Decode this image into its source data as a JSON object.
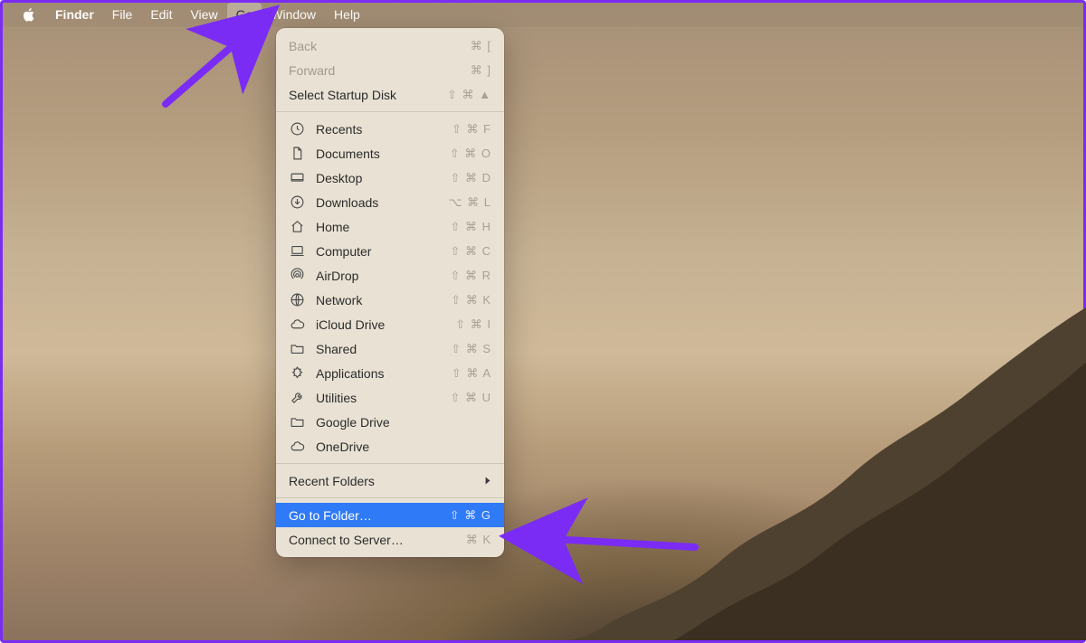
{
  "menubar": {
    "app": "Finder",
    "items": [
      "File",
      "Edit",
      "View",
      "Go",
      "Window",
      "Help"
    ],
    "open_index": 3
  },
  "dropdown": {
    "section_nav": [
      {
        "label": "Back",
        "shortcut": "⌘ [",
        "disabled": true
      },
      {
        "label": "Forward",
        "shortcut": "⌘ ]",
        "disabled": true
      },
      {
        "label": "Select Startup Disk",
        "shortcut": "⇧ ⌘ ▲"
      }
    ],
    "section_places": [
      {
        "label": "Recents",
        "shortcut": "⇧ ⌘ F",
        "icon": "clock"
      },
      {
        "label": "Documents",
        "shortcut": "⇧ ⌘ O",
        "icon": "doc"
      },
      {
        "label": "Desktop",
        "shortcut": "⇧ ⌘ D",
        "icon": "desktop"
      },
      {
        "label": "Downloads",
        "shortcut": "⌥ ⌘ L",
        "icon": "download"
      },
      {
        "label": "Home",
        "shortcut": "⇧ ⌘ H",
        "icon": "home"
      },
      {
        "label": "Computer",
        "shortcut": "⇧ ⌘ C",
        "icon": "computer"
      },
      {
        "label": "AirDrop",
        "shortcut": "⇧ ⌘ R",
        "icon": "airdrop"
      },
      {
        "label": "Network",
        "shortcut": "⇧ ⌘ K",
        "icon": "network"
      },
      {
        "label": "iCloud Drive",
        "shortcut": "⇧ ⌘ I",
        "icon": "cloud"
      },
      {
        "label": "Shared",
        "shortcut": "⇧ ⌘ S",
        "icon": "folder"
      },
      {
        "label": "Applications",
        "shortcut": "⇧ ⌘ A",
        "icon": "apps"
      },
      {
        "label": "Utilities",
        "shortcut": "⇧ ⌘ U",
        "icon": "wrench"
      },
      {
        "label": "Google Drive",
        "shortcut": "",
        "icon": "folder"
      },
      {
        "label": "OneDrive",
        "shortcut": "",
        "icon": "cloud"
      }
    ],
    "section_recent": {
      "label": "Recent Folders",
      "has_submenu": true
    },
    "section_actions": [
      {
        "label": "Go to Folder…",
        "shortcut": "⇧ ⌘ G",
        "highlight": true
      },
      {
        "label": "Connect to Server…",
        "shortcut": "⌘ K"
      }
    ]
  },
  "arrows": {
    "top_color": "#7a2cf5",
    "mid_color": "#7a2cf5"
  }
}
